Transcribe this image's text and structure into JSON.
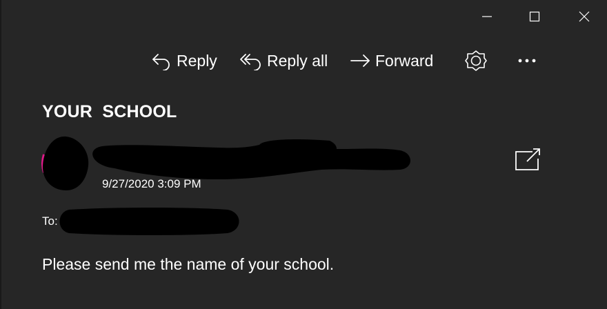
{
  "window": {
    "controls": [
      {
        "name": "minimize",
        "icon": "minimize-icon"
      },
      {
        "name": "maximize",
        "icon": "maximize-icon"
      },
      {
        "name": "close",
        "icon": "close-icon"
      }
    ]
  },
  "toolbar": {
    "reply_label": "Reply",
    "reply_all_label": "Reply all",
    "forward_label": "Forward",
    "reply_icon": "reply-icon",
    "reply_all_icon": "reply-all-icon",
    "forward_icon": "forward-icon",
    "theme_icon": "sun-icon",
    "more_icon": "more-icon"
  },
  "message": {
    "subject": "YOUR  SCHOOL",
    "date": "9/27/2020 3:09 PM",
    "to_label": "To:",
    "body": "Please send me the name of your school.",
    "popout_icon": "open-in-new-window-icon"
  },
  "colors": {
    "background": "#262626",
    "text": "#ffffff",
    "redaction": "#000000",
    "avatar_accent": "#e0198a"
  }
}
